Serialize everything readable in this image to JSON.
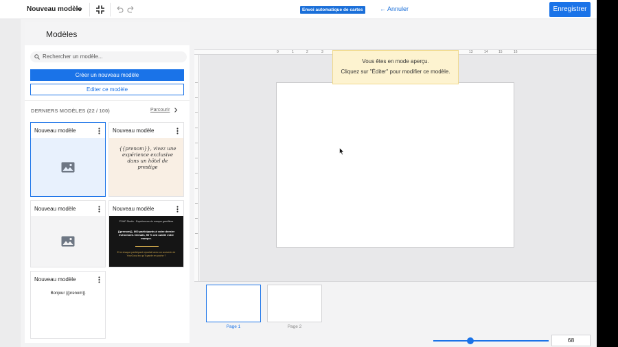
{
  "topbar": {
    "title": "Nouveau modèle",
    "badge": "Envoi automatique de cartes",
    "cancel_label": "← Annuler",
    "save_label": "Enregistrer"
  },
  "panel": {
    "title": "Modèles",
    "search_placeholder": "Rechercher un modèle...",
    "create_label": "Créer un nouveau modèle",
    "edit_label": "Editer ce modèle",
    "recent_label": "DERNIERS MODÈLES (22 / 100)",
    "browse_label": "Parcourir",
    "cards": [
      {
        "name": "Nouveau modèle",
        "thumb": "image-placeholder",
        "selected": true
      },
      {
        "name": "Nouveau modèle",
        "thumb_text": "{{prenom}}, vivez une expérience exclusive dans un hôtel de prestige"
      },
      {
        "name": "Nouveau modèle",
        "thumb": "image-placeholder"
      },
      {
        "name": "Nouveau modèle",
        "thumb_top": "POAP Studio · Expériences de marque gamifiées",
        "thumb_mid": "{{prenom}}, 800 participants à votre dernier événement. Demain, 90 % ont oublié votre marque.",
        "thumb_bot": "Et si chaque participant repartait avec un souvenir de YourCorp inc qu'il garde en poche ?"
      },
      {
        "name": "Nouveau modèle",
        "thumb_text": "Bonjour {{prenom}}"
      }
    ]
  },
  "canvas": {
    "ruler_ticks": [
      "0",
      "1",
      "2",
      "3",
      "13",
      "14",
      "15",
      "16"
    ],
    "preview_line1": "Vous êtes en mode aperçu.",
    "preview_line2": "Cliquez sur \"Éditer\" pour modifier ce modèle.",
    "pages": [
      {
        "label": "Page 1",
        "active": true
      },
      {
        "label": "Page 2",
        "active": false
      }
    ],
    "zoom_value": "68",
    "accent_color": "#1a73e8"
  }
}
